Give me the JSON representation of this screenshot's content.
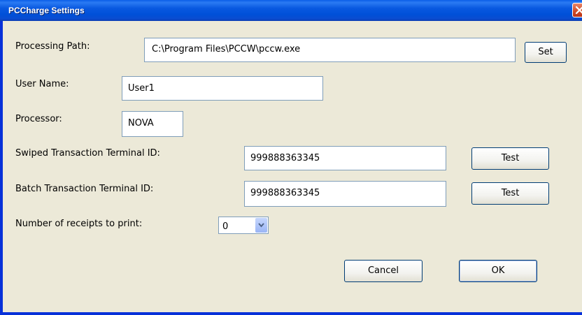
{
  "window": {
    "title": "PCCharge Settings"
  },
  "form": {
    "processing_path": {
      "label": "Processing Path:",
      "value": "C:\\Program Files\\PCCW\\pccw.exe",
      "button": "Set"
    },
    "user_name": {
      "label": "User Name:",
      "value": "User1"
    },
    "processor": {
      "label": "Processor:",
      "value": "NOVA"
    },
    "swiped_terminal": {
      "label": "Swiped Transaction Terminal ID:",
      "value": "999888363345",
      "button": "Test"
    },
    "batch_terminal": {
      "label": "Batch Transaction Terminal ID:",
      "value": "999888363345",
      "button": "Test"
    },
    "receipts": {
      "label": "Number of receipts to print:",
      "value": "0"
    }
  },
  "buttons": {
    "cancel": "Cancel",
    "ok": "OK"
  },
  "icons": {
    "close": "close-icon",
    "dropdown": "chevron-down-icon"
  },
  "colors": {
    "titlebar": "#0054e3",
    "window_bg": "#ece9d8",
    "close_button": "#d04a26",
    "field_border": "#7f9db9"
  }
}
